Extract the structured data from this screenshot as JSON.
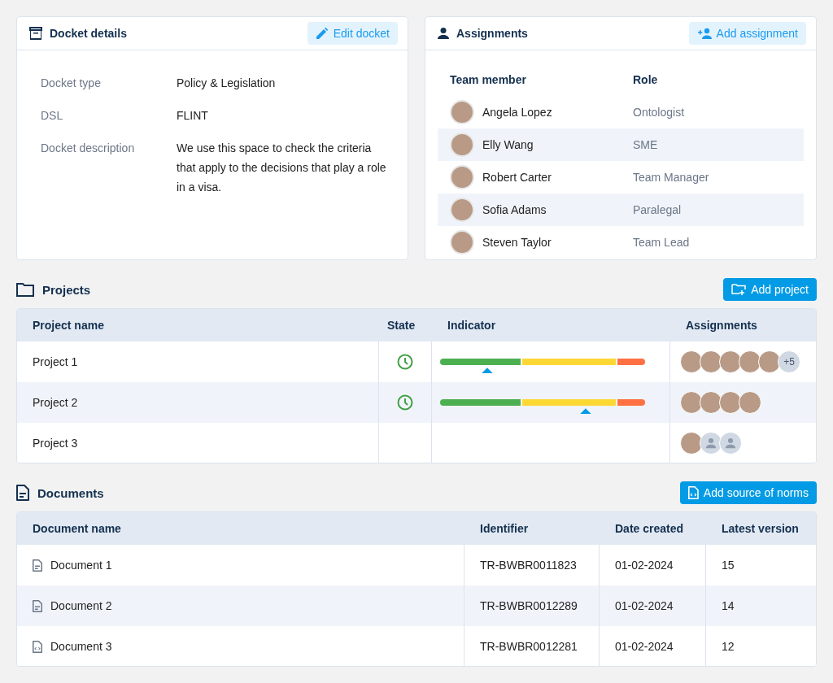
{
  "docket": {
    "title": "Docket details",
    "edit_button": "Edit docket",
    "fields": [
      {
        "label": "Docket type",
        "value": "Policy & Legislation"
      },
      {
        "label": "DSL",
        "value": "FLINT"
      },
      {
        "label": "Docket description",
        "value": "We use this space to check the criteria that apply to the decisions that play a role in a visa."
      }
    ]
  },
  "assignments": {
    "title": "Assignments",
    "add_button": "Add assignment",
    "columns": [
      "Team member",
      "Role"
    ],
    "rows": [
      {
        "name": "Angela Lopez",
        "role": "Ontologist"
      },
      {
        "name": "Elly Wang",
        "role": "SME"
      },
      {
        "name": "Robert Carter",
        "role": "Team Manager"
      },
      {
        "name": "Sofia Adams",
        "role": "Paralegal"
      },
      {
        "name": "Steven Taylor",
        "role": "Team Lead"
      }
    ]
  },
  "projects": {
    "title": "Projects",
    "add_button": "Add project",
    "columns": [
      "Project name",
      "State",
      "Indicator",
      "Assignments"
    ],
    "rows": [
      {
        "name": "Project 1",
        "pending": true,
        "indicator": {
          "level": 0.23
        },
        "avatars": [
          {
            "kind": "photo"
          },
          {
            "kind": "photo"
          },
          {
            "kind": "photo"
          },
          {
            "kind": "photo"
          },
          {
            "kind": "photo"
          }
        ],
        "more": "+5"
      },
      {
        "name": "Project 2",
        "pending": true,
        "indicator": {
          "level": 0.71
        },
        "avatars": [
          {
            "kind": "photo"
          },
          {
            "kind": "photo"
          },
          {
            "kind": "photo"
          },
          {
            "kind": "photo"
          }
        ]
      },
      {
        "name": "Project 3",
        "pending": false,
        "avatars": [
          {
            "kind": "photo"
          },
          {
            "kind": "placeholder"
          },
          {
            "kind": "placeholder"
          }
        ]
      }
    ]
  },
  "documents": {
    "title": "Documents",
    "add_button": "Add source of norms",
    "columns": [
      "Document name",
      "Identifier",
      "Date created",
      "Latest version"
    ],
    "rows": [
      {
        "kind": "text",
        "name": "Document 1",
        "identifier": "TR-BWBR0011823",
        "date": "01-02-2024",
        "version": "15"
      },
      {
        "kind": "text",
        "name": "Document 2",
        "identifier": "TR-BWBR0012289",
        "date": "01-02-2024",
        "version": "14"
      },
      {
        "kind": "code",
        "name": "Document 3",
        "identifier": "TR-BWBR0012281",
        "date": "01-02-2024",
        "version": "12"
      }
    ]
  }
}
